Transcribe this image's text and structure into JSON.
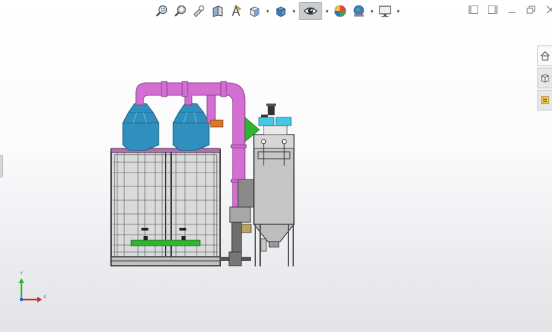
{
  "heads_up_toolbar": {
    "items": [
      {
        "name": "zoom-to-fit",
        "icon": "zoom-fit-icon"
      },
      {
        "name": "zoom-to-area",
        "icon": "zoom-area-icon"
      },
      {
        "name": "previous-view",
        "icon": "previous-view-icon"
      },
      {
        "name": "section-view",
        "icon": "section-view-icon"
      },
      {
        "name": "dynamic-annotation",
        "icon": "annotation-views-icon"
      },
      {
        "name": "view-orientation",
        "icon": "view-orientation-icon"
      },
      {
        "name": "display-style",
        "icon": "display-style-icon"
      },
      {
        "name": "hide-show-items",
        "icon": "hide-show-icon",
        "active": true
      },
      {
        "name": "edit-appearance",
        "icon": "edit-appearance-icon"
      },
      {
        "name": "apply-scene",
        "icon": "apply-scene-icon"
      },
      {
        "name": "view-settings",
        "icon": "monitor-icon"
      }
    ]
  },
  "window_controls": [
    "tile-left-icon",
    "tile-right-icon",
    "minimize-icon",
    "restore-icon",
    "close-icon"
  ],
  "task_pane_tabs": [
    "home-icon",
    "parts-library-icon",
    "file-explorer-icon"
  ],
  "triad": {
    "y_label": "Y",
    "x_label": "X"
  },
  "colors": {
    "duct": "#d36fd3",
    "hood": "#2f8fbf",
    "cabinet": "#6d6d6d",
    "collector": "#c6c6c6",
    "fan_green": "#2fb52f",
    "cyan": "#45c7e6"
  }
}
